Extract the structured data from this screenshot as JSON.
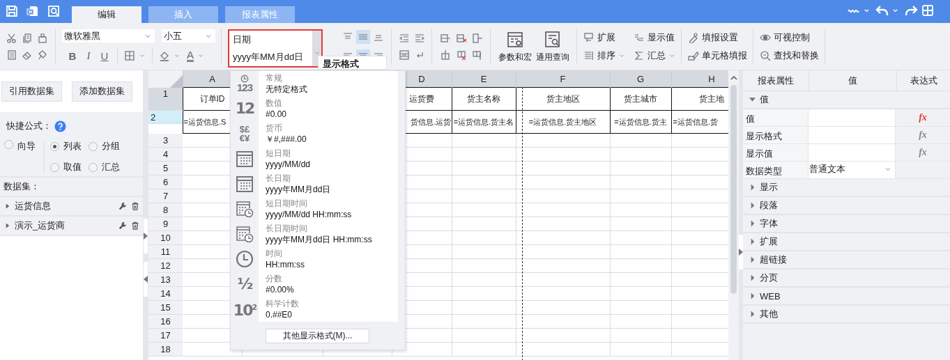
{
  "tabs": [
    {
      "label": "编辑",
      "selected": true
    },
    {
      "label": "插入",
      "selected": false
    },
    {
      "label": "报表属性",
      "selected": false
    }
  ],
  "font": {
    "family": "微软雅黑",
    "size": "小五"
  },
  "style_buttons": [
    {
      "label": "B",
      "on": false
    },
    {
      "label": "I",
      "on": false
    },
    {
      "label": "U",
      "on": false
    }
  ],
  "font_color_glyph": "A",
  "format_box": {
    "category": "日期",
    "pattern": "yyyy年MM月dd日",
    "tooltip": "显示格式"
  },
  "align_buttons": [
    {
      "selected": false
    },
    {
      "selected": true
    },
    {
      "selected": false
    },
    {
      "selected": false
    },
    {
      "selected": true
    },
    {
      "selected": false
    }
  ],
  "big_buttons": [
    "参数和宏",
    "通用查询"
  ],
  "actions": [
    {
      "label": "扩展",
      "menu": false
    },
    {
      "label": "排序",
      "menu": true
    },
    {
      "label": "显示值",
      "menu": false
    },
    {
      "label": "汇总",
      "menu": true
    },
    {
      "label": "填报设置",
      "menu": false
    },
    {
      "label": "单元格填报",
      "menu": false
    },
    {
      "label": "可视控制",
      "menu": false
    },
    {
      "label": "查找和替换",
      "menu": false
    }
  ],
  "left_panel": {
    "buttons": [
      "引用数据集",
      "添加数据集"
    ],
    "formula_label": "快捷公式：",
    "modes": [
      {
        "label": "向导",
        "selected": false
      },
      {
        "label": "列表",
        "selected": true
      },
      {
        "label": "分组",
        "selected": false
      },
      {
        "label": "取值",
        "selected": false
      },
      {
        "label": "汇总",
        "selected": false
      }
    ],
    "datasets_label": "数据集：",
    "datasets": [
      {
        "name": "运货信息",
        "expanded": false
      },
      {
        "name": "演示_运货商",
        "expanded": false
      }
    ]
  },
  "grid": {
    "columns": [
      {
        "label": "A"
      },
      null,
      null,
      {
        "label": "D"
      },
      {
        "label": "E"
      },
      {
        "label": "F"
      },
      {
        "label": "G"
      },
      {
        "label": "H"
      }
    ],
    "rows": [
      {
        "number": "1",
        "selected": false,
        "shaded": true,
        "cells": [
          "订单ID",
          null,
          null,
          "运货费",
          "货主名称",
          "货主地区",
          "货主城市",
          "货主地"
        ]
      },
      {
        "number": "2",
        "selected": true,
        "cells": [
          "=运货信息.S",
          null,
          null,
          "货信息.运货",
          "=运货信息.货主名",
          "=运货信息.货主地区",
          "=运货信息.货主",
          "=运货信息.货"
        ]
      },
      {
        "number": "3",
        "selected": false
      },
      {
        "number": "4",
        "selected": false
      },
      {
        "number": "5",
        "selected": false
      },
      {
        "number": "6",
        "selected": false
      },
      {
        "number": "7",
        "selected": false
      },
      {
        "number": "8",
        "selected": false
      },
      {
        "number": "9",
        "selected": false
      },
      {
        "number": "10",
        "selected": false
      },
      {
        "number": "11",
        "selected": false
      },
      {
        "number": "12",
        "selected": false
      },
      {
        "number": "13",
        "selected": false
      },
      {
        "number": "14",
        "selected": false
      },
      {
        "number": "15",
        "selected": false
      },
      {
        "number": "16",
        "selected": false
      },
      {
        "number": "17",
        "selected": false
      },
      {
        "number": "18",
        "selected": false
      }
    ]
  },
  "format_menu": {
    "items": [
      {
        "kind": "general",
        "glyph": "123",
        "name": "常规",
        "pattern": "无特定格式"
      },
      {
        "kind": "glyph",
        "glyph": "12",
        "name": "数值",
        "pattern": "#0.00"
      },
      {
        "kind": "currency",
        "glyph": "$£€¥",
        "name": "货币",
        "pattern": "￥#,###.00"
      },
      {
        "kind": "date",
        "name": "短日期",
        "pattern": "yyyy/MM/dd"
      },
      {
        "kind": "date",
        "name": "长日期",
        "pattern": "yyyy年MM月dd日"
      },
      {
        "kind": "datetime",
        "name": "短日期时间",
        "pattern": "yyyy/MM/dd HH:mm:ss"
      },
      {
        "kind": "datetime",
        "name": "长日期时间",
        "pattern": "yyyy年MM月dd日 HH:mm:ss"
      },
      {
        "kind": "time",
        "name": "时间",
        "pattern": "HH:mm:ss"
      },
      {
        "kind": "glyph",
        "glyph": "½",
        "name": "分数",
        "pattern": "#0.00%"
      },
      {
        "kind": "glyph",
        "glyph": "10$^{2}$",
        "name": "科学计数",
        "pattern": "0.##E0"
      }
    ],
    "more_button": "其他显示格式(M)..."
  },
  "properties": {
    "columns": [
      "报表属性",
      "值",
      "表达式"
    ],
    "groups": [
      {
        "name": "值",
        "expanded": true,
        "rows": [
          {
            "kind": "formula",
            "label": "值",
            "formula": "fx",
            "formula_set": true
          },
          {
            "kind": "formula",
            "label": "显示格式",
            "formula": "fx",
            "formula_set": false
          },
          {
            "kind": "formula",
            "label": "显示值",
            "formula": "fx",
            "formula_set": false
          },
          {
            "kind": "select",
            "label": "数据类型",
            "value": "普通文本"
          }
        ]
      },
      {
        "name": "显示",
        "expanded": false
      },
      {
        "name": "段落",
        "expanded": false
      },
      {
        "name": "字体",
        "expanded": false
      },
      {
        "name": "扩展",
        "expanded": false
      },
      {
        "name": "超链接",
        "expanded": false
      },
      {
        "name": "分页",
        "expanded": false
      },
      {
        "name": "WEB",
        "expanded": false
      },
      {
        "name": "其他",
        "expanded": false
      }
    ]
  }
}
